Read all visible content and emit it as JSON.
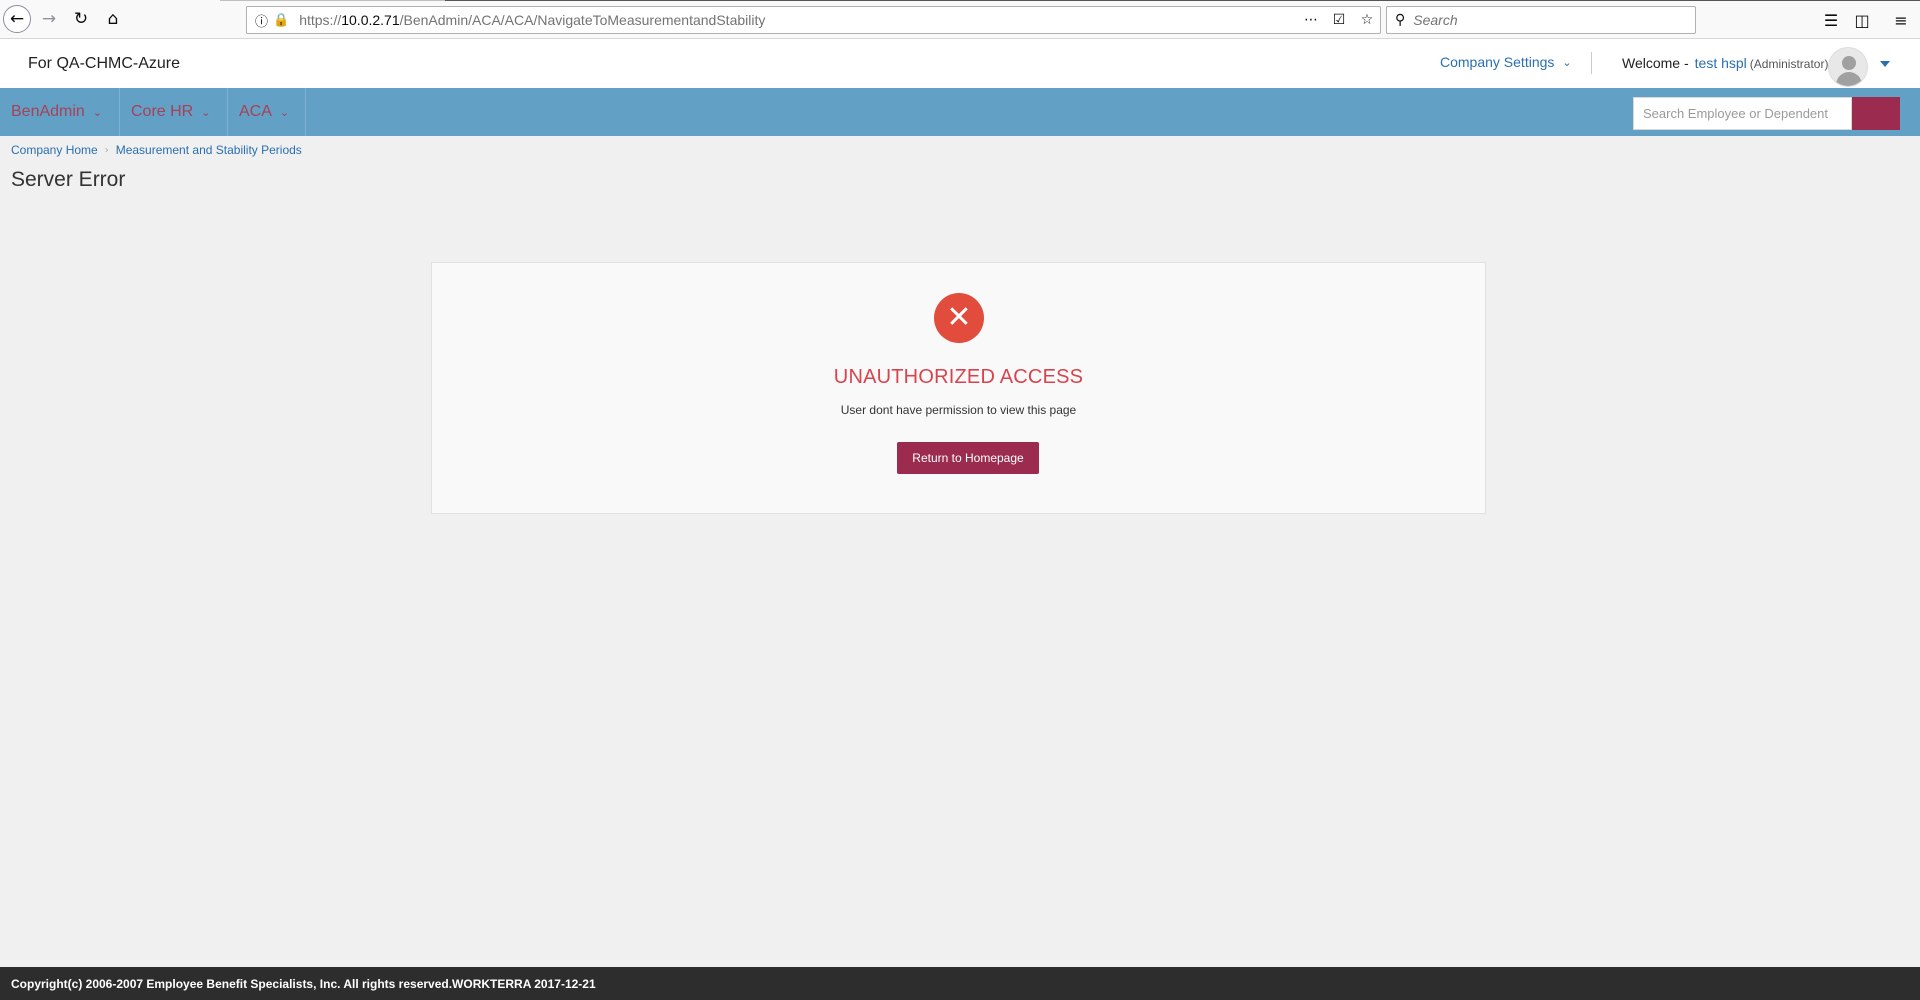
{
  "browser": {
    "url_prefix": "https://",
    "url_host": "10.0.2.71",
    "url_path": "/BenAdmin/ACA/ACA/NavigateToMeasurementandStability",
    "search_placeholder": "Search"
  },
  "header": {
    "company_name": "For QA-CHMC-Azure",
    "company_settings_label": "Company Settings",
    "welcome_label": "Welcome -",
    "user_name": "test hspl",
    "user_role": "(Administrator)"
  },
  "nav": {
    "items": [
      {
        "label": "BenAdmin"
      },
      {
        "label": "Core HR"
      },
      {
        "label": "ACA"
      }
    ],
    "search_placeholder": "Search Employee or Dependent"
  },
  "breadcrumb": {
    "items": [
      {
        "label": "Company Home"
      },
      {
        "label": "Measurement and Stability Periods"
      }
    ]
  },
  "page": {
    "title": "Server Error"
  },
  "error": {
    "heading": "UNAUTHORIZED ACCESS",
    "message": "User dont have permission to view this page",
    "button_label": "Return to Homepage"
  },
  "footer": {
    "copyright": "Copyright(c) 2006-2007 Employee Benefit Specialists, Inc. All rights reserved.WORKTERRA 2017-12-21"
  },
  "colors": {
    "nav_bg": "#63a0c6",
    "accent": "#9b2c4f",
    "error_red": "#e24c3c",
    "link_blue": "#2a6fb0"
  }
}
